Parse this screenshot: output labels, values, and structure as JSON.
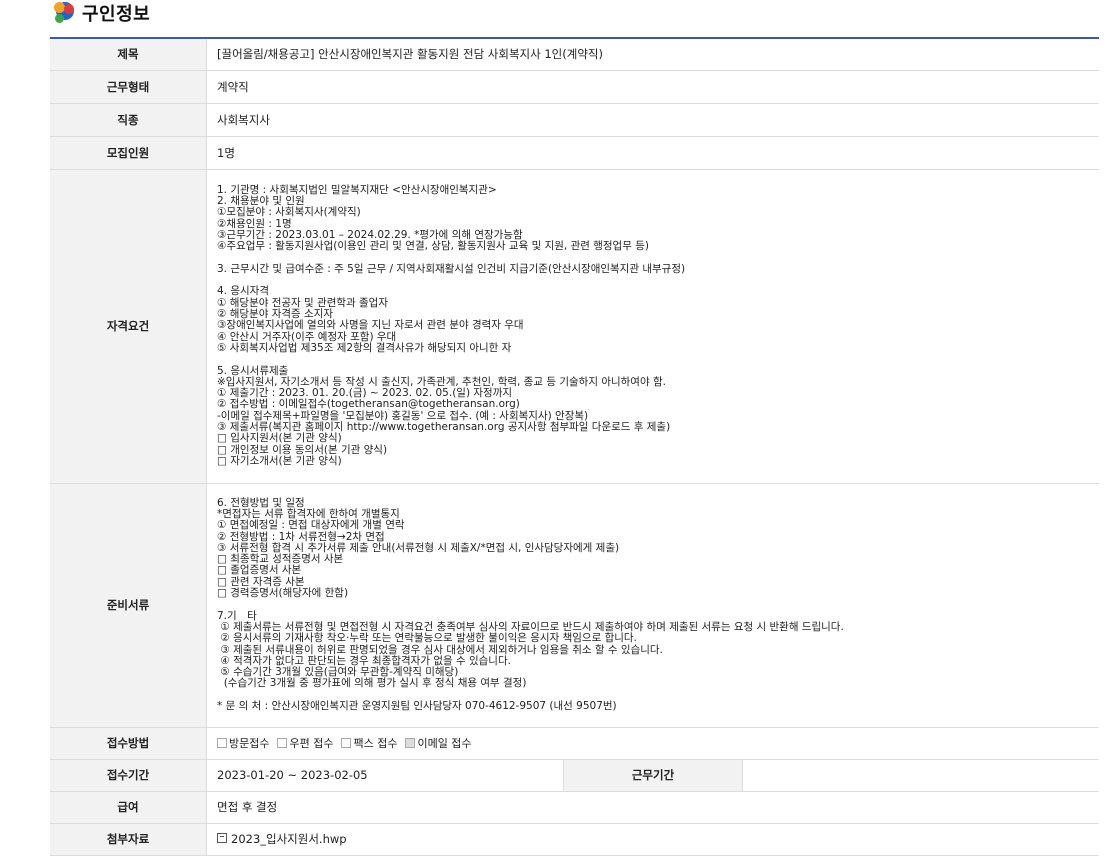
{
  "section": {
    "title": "구인정보",
    "icon": "colorful-dots-logo"
  },
  "rows": {
    "title": {
      "label": "제목",
      "value": "[끌어올림/채용공고] 안산시장애인복지관 활동지원 전담 사회복지사 1인(계약직)"
    },
    "employment": {
      "label": "근무형태",
      "value": "계약직"
    },
    "job": {
      "label": "직종",
      "value": "사회복지사"
    },
    "recruits": {
      "label": "모집인원",
      "value": "1명"
    },
    "qualifications": {
      "label": "자격요건",
      "value": "1. 기관명 : 사회복지법인 밀알복지재단 <안산시장애인복지관>\n2. 채용분야 및 인원\n①모집분야 : 사회복지사(계약직)\n②채용인원 : 1명\n③근무기간 : 2023.03.01 – 2024.02.29. *평가에 의해 연장가능함\n④주요업무 : 활동지원사업(이용인 관리 및 연결, 상담, 활동지원사 교육 및 지원, 관련 행정업무 등)\n\n3. 근무시간 및 급여수준 : 주 5일 근무 / 지역사회재활시설 인건비 지급기준(안산시장애인복지관 내부규정)\n\n4. 응시자격\n① 해당분야 전공자 및 관련학과 졸업자\n② 해당분야 자격증 소지자\n③장애인복지사업에 열의와 사명을 지닌 자로서 관련 분야 경력자 우대\n④ 안산시 거주자(이주 예정자 포함) 우대\n⑤ 사회복지사업법 제35조 제2항의 결격사유가 해당되지 아니한 자\n\n5. 응시서류제출\n※입사지원서, 자기소개서 등 작성 시 출신지, 가족관계, 추천인, 학력, 종교 등 기술하지 아니하여야 함.\n① 제출기간 : 2023. 01. 20.(금) ~ 2023. 02. 05.(일) 자정까지\n② 접수방법 : 이메일접수(togetheransan@togetheransan.org)\n-이메일 접수제목+파일명을 '모집분야) 홍길동' 으로 접수. (예 : 사회복지사) 안장복)\n③ 제출서류(복지관 홈페이지 http://www.togetheransan.org 공지사항 첨부파일 다운로드 후 제출)\n□ 입사지원서(본 기관 양식)\n□ 개인정보 이용 동의서(본 기관 양식)\n□ 자기소개서(본 기관 양식)"
    },
    "documents": {
      "label": "준비서류",
      "value": "6. 전형방법 및 일정\n*면접자는 서류 합격자에 한하여 개별통지\n① 면접예정일 : 면접 대상자에게 개별 연락\n② 전형방법 : 1차 서류전형→2차 면접\n③ 서류전형 합격 시 추가서류 제출 안내(서류전형 시 제출X/*면접 시, 인사담당자에게 제출)\n□ 최종학교 성적증명서 사본\n□ 졸업증명서 사본\n□ 관련 자격증 사본\n□ 경력증명서(해당자에 한함)\n\n7.기　타\n ① 제출서류는 서류전형 및 면접전형 시 자격요건 충족여부 심사의 자료이므로 반드시 제출하여야 하며 제출된 서류는 요청 시 반환해 드립니다.\n ② 응시서류의 기재사항 착오·누락 또는 연락불능으로 발생한 불이익은 응시자 책임으로 합니다.\n ③ 제출된 서류내용이 허위로 판명되었을 경우 심사 대상에서 제외하거나 임용을 취소 할 수 있습니다.\n ④ 적격자가 없다고 판단되는 경우 최종합격자가 없을 수 있습니다.\n ⑤ 수습기간 3개월 있음(급여와 무관함-계약직 미해당)\n  (수습기간 3개월 중 평가표에 의해 평가 실시 후 정식 채용 여부 결정)\n\n* 문 의 처 : 안산시장애인복지관 운영지원팀 인사담당자 070-4612-9507 (내선 9507번)"
    },
    "method": {
      "label": "접수방법",
      "options": [
        {
          "label": "방문접수",
          "checked": false
        },
        {
          "label": "우편 접수",
          "checked": false
        },
        {
          "label": "팩스 접수",
          "checked": false
        },
        {
          "label": "이메일 접수",
          "checked": true
        }
      ]
    },
    "period": {
      "label": "접수기간",
      "value": "2023-01-20 ~ 2023-02-05",
      "work_label": "근무기간",
      "work_value": ""
    },
    "salary": {
      "label": "급여",
      "value": "면접 후 결정"
    },
    "attachment": {
      "label": "첨부자료",
      "value": "2023_입사지원서.hwp"
    }
  }
}
